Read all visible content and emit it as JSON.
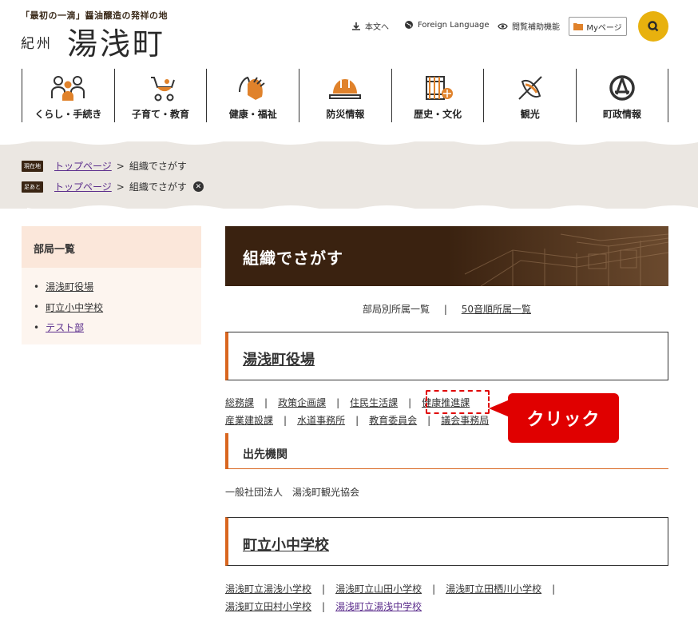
{
  "header": {
    "tagline": "「最初の一滴」醤油醸造の発祥の地",
    "town_prefix": "紀州",
    "town_name": "湯浅町",
    "util_honbun": "本文へ",
    "util_foreign": "Foreign Language",
    "util_access": "閲覧補助機能",
    "mypage": "Myページ"
  },
  "gnav": [
    {
      "label": "くらし・手続き",
      "icon": "people-icon"
    },
    {
      "label": "子育て・教育",
      "icon": "stroller-icon"
    },
    {
      "label": "健康・福祉",
      "icon": "caring-hands-icon"
    },
    {
      "label": "防災情報",
      "icon": "helmet-icon"
    },
    {
      "label": "歴史・文化",
      "icon": "barrel-icon"
    },
    {
      "label": "観光",
      "icon": "canoe-icon"
    },
    {
      "label": "町政情報",
      "icon": "emblem-icon"
    }
  ],
  "breadcrumb": {
    "current_tag": "現在地",
    "history_tag": "足あと",
    "top_link": "トップページ",
    "separator": ">",
    "current_page": "組織でさがす"
  },
  "sidebar": {
    "heading": "部局一覧",
    "items": [
      "湯浅町役場",
      "町立小中学校",
      "テスト部"
    ]
  },
  "main": {
    "banner_title": "組織でさがす",
    "tab_links": [
      "部局別所属一覧",
      "50音順所属一覧"
    ],
    "tab_sep": "|",
    "section1_title": "湯浅町役場",
    "section1_row1": [
      "総務課",
      "政策企画課",
      "住民生活課",
      "健康推進課"
    ],
    "section1_row2": [
      "産業建設課",
      "水道事務所",
      "教育委員会",
      "議会事務局"
    ],
    "dest_heading": "出先機関",
    "dest_text": "一般社団法人　湯浅町観光協会",
    "section2_title": "町立小中学校",
    "section2_row1": [
      "湯浅町立湯浅小学校",
      "湯浅町立山田小学校",
      "湯浅町立田栖川小学校"
    ],
    "section2_row2": [
      "湯浅町立田村小学校",
      "湯浅町立湯浅中学校"
    ]
  },
  "annotation": {
    "callout": "クリック"
  },
  "colors": {
    "accent_orange": "#d9661f",
    "banner_brown": "#3a2210",
    "search_yellow": "#e8b10e",
    "annotation_red": "#e00000",
    "visited_purple": "#5b2d8c"
  }
}
